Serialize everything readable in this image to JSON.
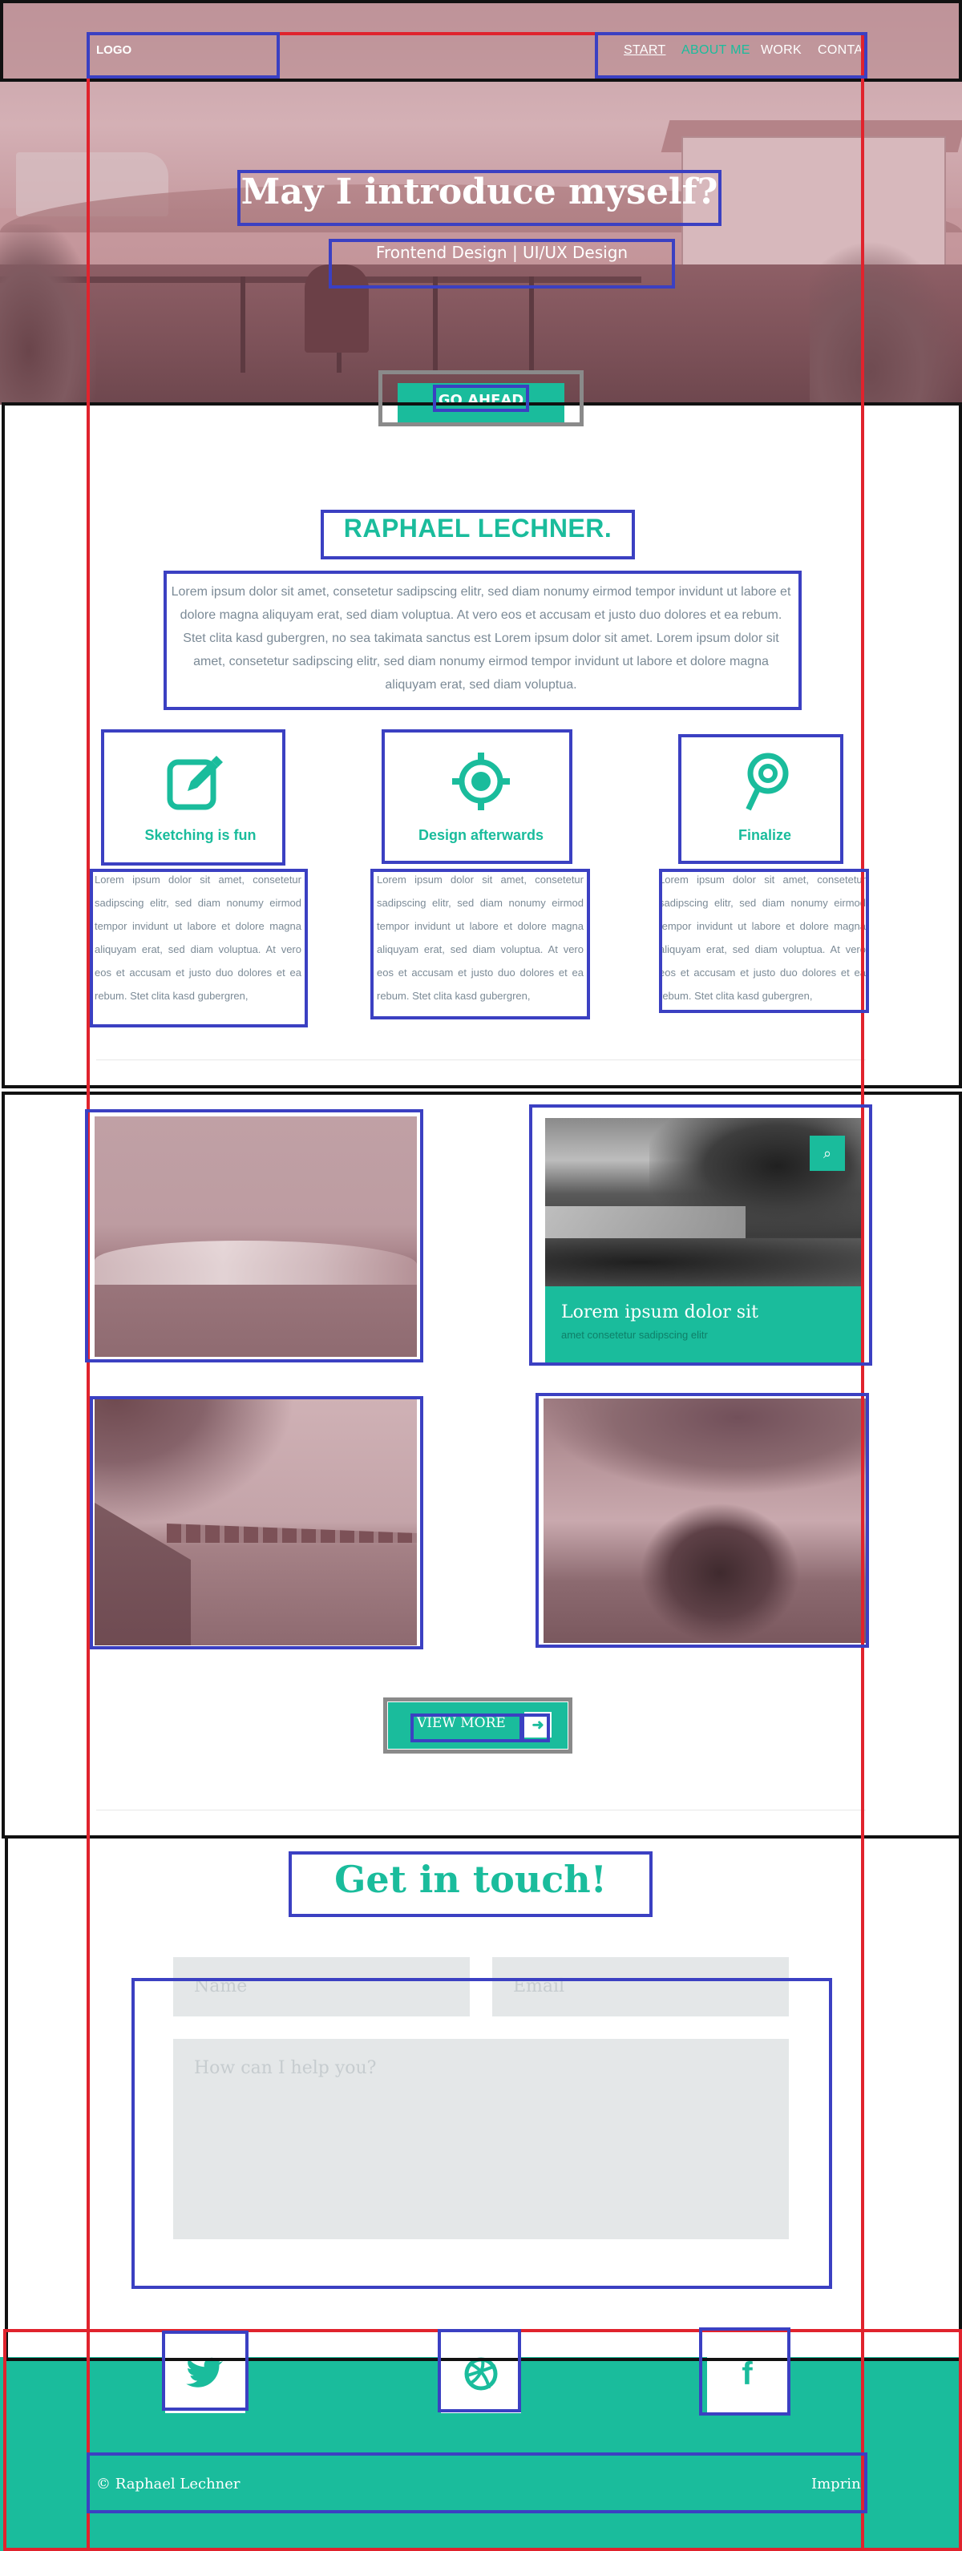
{
  "nav": {
    "logo": "LOGO",
    "items": [
      "START",
      "ABOUT ME",
      "WORK",
      "CONTACT"
    ]
  },
  "hero": {
    "title": "May I introduce myself?",
    "subtitle": "Frontend Design | UI/UX Design",
    "cta": "GO AHEAD"
  },
  "about": {
    "name": "RAPHAEL   LECHNER.",
    "text": "Lorem ipsum dolor sit amet, consetetur sadipscing elitr, sed diam nonumy eirmod tempor invidunt ut labore et dolore magna aliquyam erat, sed diam voluptua. At vero eos et accusam et justo duo dolores et ea rebum. Stet clita kasd gubergren, no sea takimata sanctus est Lorem ipsum dolor sit amet. Lorem ipsum dolor sit amet, consetetur sadipscing elitr, sed diam nonumy eirmod tempor invidunt ut labore et dolore magna aliquyam erat, sed diam voluptua.",
    "features": [
      {
        "title": "Sketching is fun",
        "icon": "edit-icon",
        "text": "Lorem ipsum dolor sit amet, consetetur sadipscing elitr, sed diam nonumy eirmod tempor invidunt ut labore et dolore magna aliquyam erat, sed diam voluptua. At vero eos et accusam et justo duo dolores et ea rebum. Stet clita kasd gubergren,"
      },
      {
        "title": "Design afterwards",
        "icon": "target-icon",
        "text": "Lorem ipsum dolor sit amet, consetetur sadipscing elitr, sed diam nonumy eirmod tempor invidunt ut labore et dolore magna aliquyam erat, sed diam voluptua. At vero eos et accusam et justo duo dolores et ea rebum. Stet clita kasd gubergren,"
      },
      {
        "title": "Finalize",
        "icon": "lollipop-icon",
        "text": "Lorem ipsum dolor sit amet, consetetur sadipscing elitr, sed diam nonumy eirmod tempor invidunt ut labore et dolore magna aliquyam erat, sed diam voluptua. At vero eos et accusam et justo duo dolores et ea rebum. Stet clita kasd gubergren,"
      }
    ]
  },
  "work": {
    "featured_title": "Lorem ipsum dolor sit",
    "featured_subtitle": "amet consetetur sadipscing elitr",
    "view_more": "VIEW MORE"
  },
  "contact": {
    "title": "Get in touch!",
    "name_placeholder": "Name",
    "email_placeholder": "Email",
    "message_placeholder": "How can I help you?"
  },
  "footer": {
    "copyright": "© Raphael Lechner",
    "imprint": "Imprint",
    "social": [
      "twitter-icon",
      "dribbble-icon",
      "facebook-icon"
    ]
  },
  "colors": {
    "accent": "#1abc9c",
    "overlay": "#b8888e"
  }
}
